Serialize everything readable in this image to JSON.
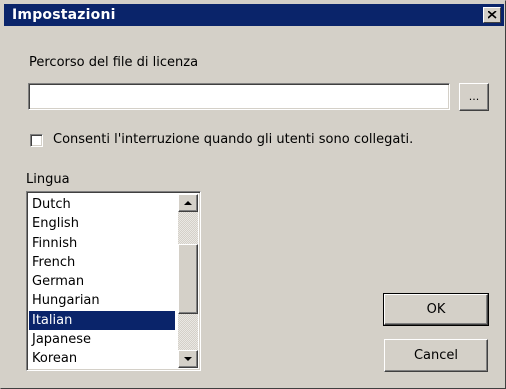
{
  "window": {
    "title": "Impostazioni",
    "close_glyph": "✕",
    "active_title_color": "#0a246a"
  },
  "license": {
    "label": "Percorso del file di licenza",
    "path_value": "",
    "browse_label": "..."
  },
  "interrupt": {
    "label": "Consenti l'interruzione quando gli utenti sono collegati.",
    "checked": false
  },
  "language": {
    "label": "Lingua",
    "items": [
      "Dutch",
      "English",
      "Finnish",
      "French",
      "German",
      "Hungarian",
      "Italian",
      "Japanese",
      "Korean"
    ],
    "selected": "Italian"
  },
  "buttons": {
    "ok": "OK",
    "cancel": "Cancel"
  }
}
